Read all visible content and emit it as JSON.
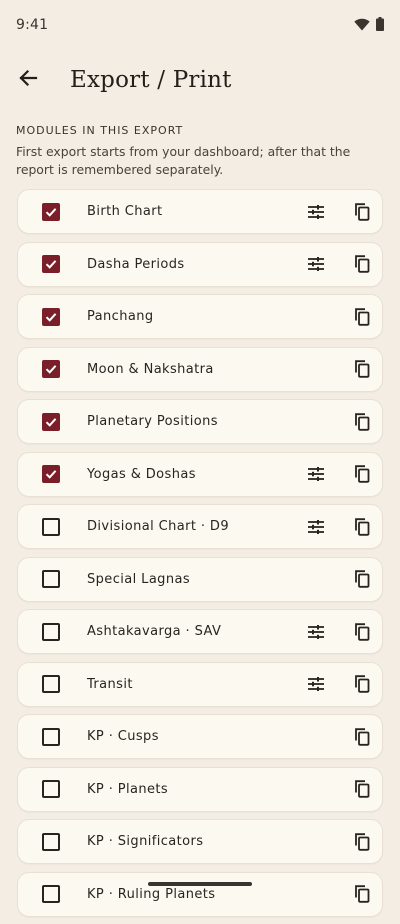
{
  "status_bar": {
    "time": "9:41",
    "icons": [
      "wifi-icon",
      "battery-icon"
    ]
  },
  "app_bar": {
    "back_icon": "arrow-back-icon",
    "title": "Export / Print"
  },
  "section": {
    "header": "MODULES IN THIS EXPORT",
    "description": "First export starts from your dashboard; after that the report is remembered separately."
  },
  "colors": {
    "background": "#f3ede4",
    "card": "#fcf9f1",
    "accent": "#7a1f2a"
  },
  "modules": [
    {
      "label": "Birth Chart",
      "checked": true,
      "has_tune": true
    },
    {
      "label": "Dasha Periods",
      "checked": true,
      "has_tune": true
    },
    {
      "label": "Panchang",
      "checked": true,
      "has_tune": false
    },
    {
      "label": "Moon & Nakshatra",
      "checked": true,
      "has_tune": false
    },
    {
      "label": "Planetary Positions",
      "checked": true,
      "has_tune": false
    },
    {
      "label": "Yogas & Doshas",
      "checked": true,
      "has_tune": true
    },
    {
      "label": "Divisional Chart · D9",
      "checked": false,
      "has_tune": true
    },
    {
      "label": "Special Lagnas",
      "checked": false,
      "has_tune": false
    },
    {
      "label": "Ashtakavarga · SAV",
      "checked": false,
      "has_tune": true
    },
    {
      "label": "Transit",
      "checked": false,
      "has_tune": true
    },
    {
      "label": "KP · Cusps",
      "checked": false,
      "has_tune": false
    },
    {
      "label": "KP · Planets",
      "checked": false,
      "has_tune": false
    },
    {
      "label": "KP · Significators",
      "checked": false,
      "has_tune": false
    },
    {
      "label": "KP · Ruling Planets",
      "checked": false,
      "has_tune": false
    }
  ]
}
